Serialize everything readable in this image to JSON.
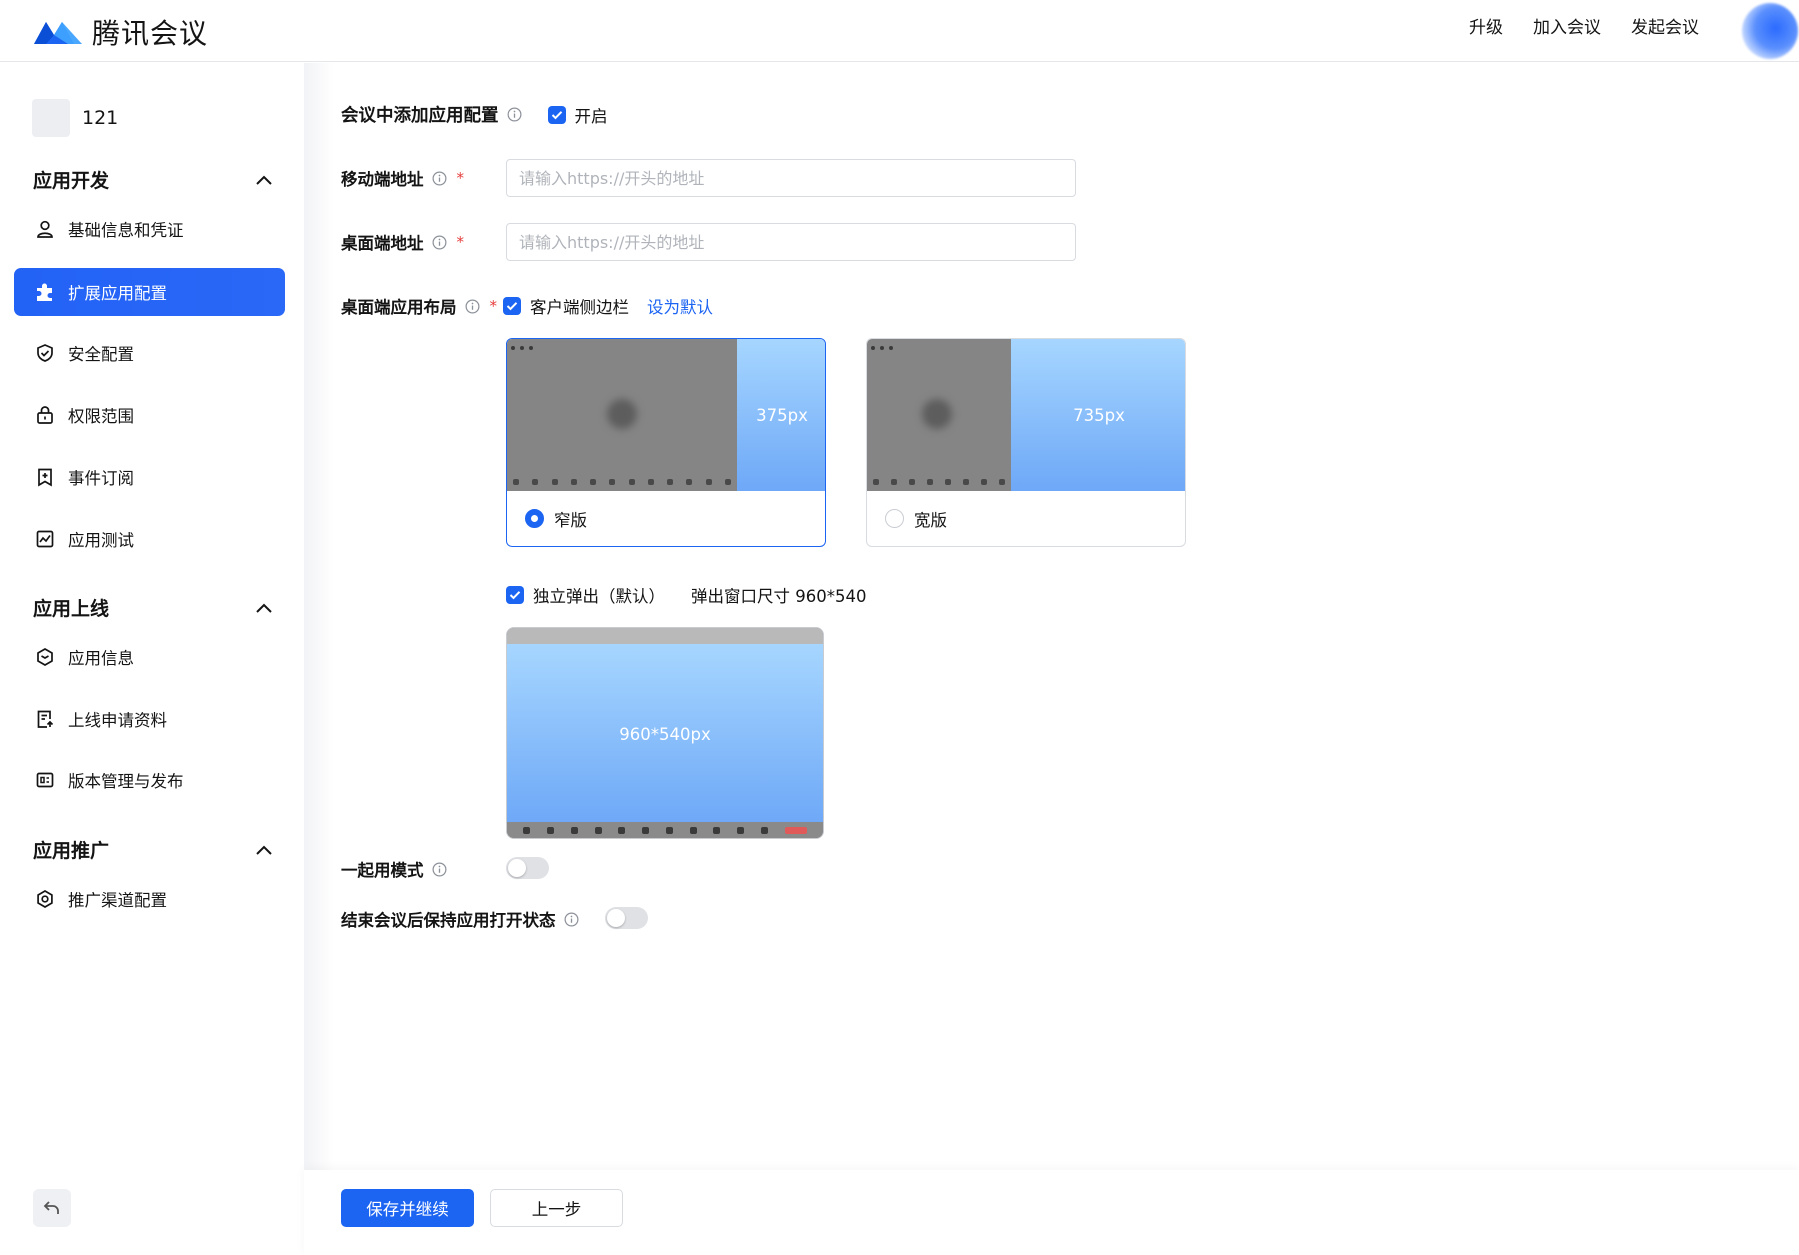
{
  "header": {
    "brand": "腾讯会议",
    "nav": [
      "升级",
      "加入会议",
      "发起会议"
    ]
  },
  "sidebar": {
    "app_name": "121",
    "groups": [
      {
        "title": "应用开发",
        "items": [
          "基础信息和凭证",
          "扩展应用配置",
          "安全配置",
          "权限范围",
          "事件订阅",
          "应用测试"
        ]
      },
      {
        "title": "应用上线",
        "items": [
          "应用信息",
          "上线申请资料",
          "版本管理与发布"
        ]
      },
      {
        "title": "应用推广",
        "items": [
          "推广渠道配置"
        ]
      }
    ],
    "active_item": "扩展应用配置"
  },
  "form": {
    "add_app_config": {
      "label": "会议中添加应用配置",
      "checkbox_label": "开启",
      "checked": true
    },
    "mobile_url": {
      "label": "移动端地址",
      "required_mark": "*",
      "placeholder": "请输入https://开头的地址",
      "value": ""
    },
    "desktop_url": {
      "label": "桌面端地址",
      "required_mark": "*",
      "placeholder": "请输入https://开头的地址",
      "value": ""
    },
    "desktop_layout": {
      "label": "桌面端应用布局",
      "required_mark": "*",
      "sidebar_checkbox_label": "客户端侧边栏",
      "sidebar_checked": true,
      "set_default_link": "设为默认",
      "options": [
        {
          "name": "窄版",
          "width_label": "375px",
          "selected": true
        },
        {
          "name": "宽版",
          "width_label": "735px",
          "selected": false
        }
      ],
      "popup_checkbox_label": "独立弹出（默认）",
      "popup_checked": true,
      "popup_size_text": "弹出窗口尺寸 960*540",
      "popup_preview_label": "960*540px"
    },
    "together_mode": {
      "label": "一起用模式",
      "on": false
    },
    "keep_open": {
      "label": "结束会议后保持应用打开状态",
      "on": false
    }
  },
  "footer": {
    "primary": "保存并继续",
    "secondary": "上一步"
  },
  "colors": {
    "accent": "#1c64f2",
    "required": "#e63d3d",
    "preview_blue_top": "#a6d6ff",
    "preview_blue_bottom": "#6ea8f7"
  }
}
